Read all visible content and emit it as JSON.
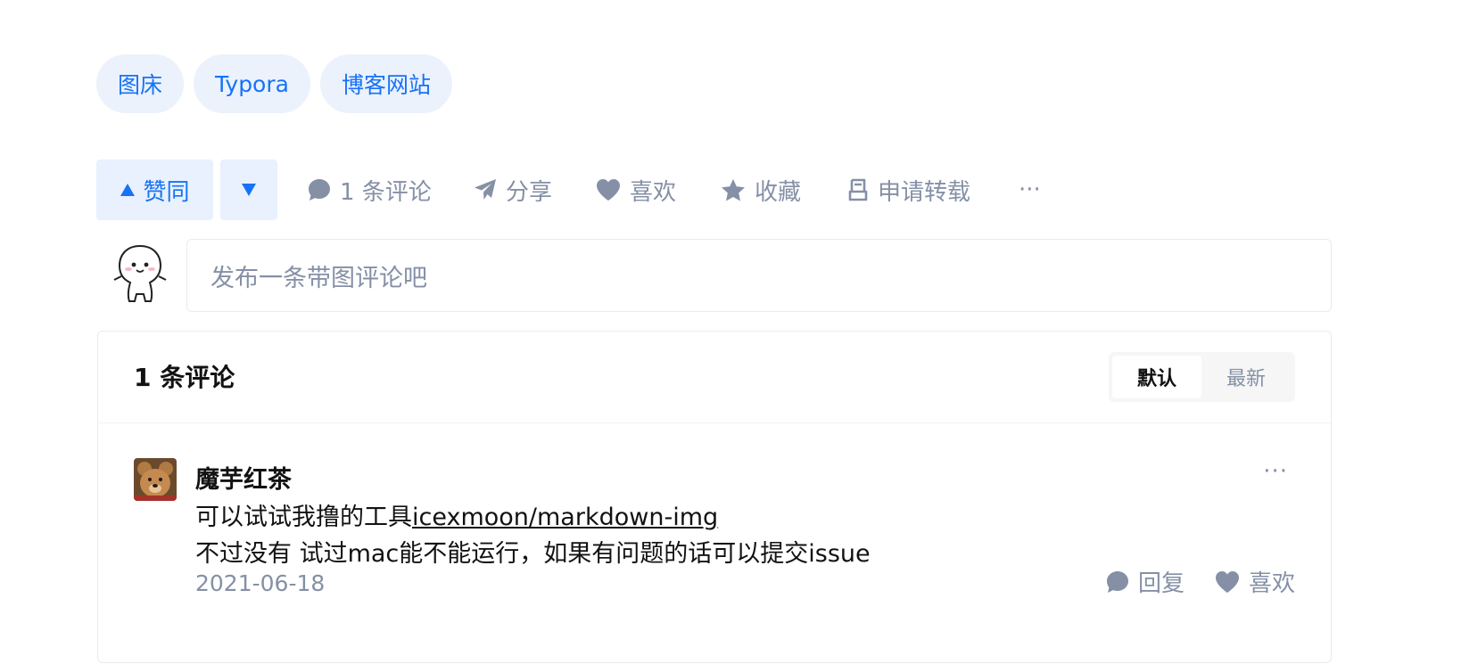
{
  "tags": [
    "图床",
    "Typora",
    "博客网站"
  ],
  "actions": {
    "vote_up_label": "赞同",
    "comments_label": "1 条评论",
    "share_label": "分享",
    "like_label": "喜欢",
    "collect_label": "收藏",
    "repost_label": "申请转载",
    "more_label": "···"
  },
  "comment_input": {
    "placeholder": "发布一条带图评论吧"
  },
  "comments_panel": {
    "title": "1 条评论",
    "sort_options": [
      "默认",
      "最新"
    ],
    "active_sort": "默认",
    "comments": [
      {
        "author": "魔芋红茶",
        "text_prefix": "可以试试我撸的工具",
        "link_text": "icexmoon/markdown-img",
        "text_line2": "不过没有 试过mac能不能运行，如果有问题的话可以提交issue",
        "date": "2021-06-18",
        "reply_label": "回复",
        "like_label": "喜欢",
        "more_label": "···"
      }
    ]
  },
  "colors": {
    "brand_blue": "#1772f6",
    "tag_bg": "#ebf2fc",
    "muted_gray": "#8590a6",
    "text": "#121212"
  }
}
